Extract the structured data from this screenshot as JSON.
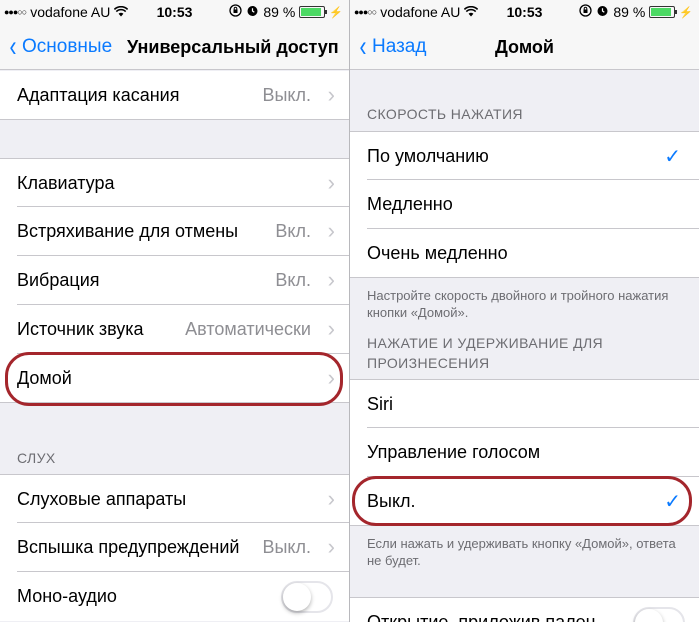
{
  "status_bar": {
    "signal": "●●●○○",
    "carrier": "vodafone AU",
    "wifi": "wifi-icon",
    "time": "10:53",
    "battery_percent": "89 %",
    "battery_level": 0.89
  },
  "left": {
    "nav": {
      "back_label": "Основные",
      "title": "Универсальный доступ"
    },
    "rows": {
      "touch_accommodations": {
        "label": "Адаптация касания",
        "value": "Выкл."
      },
      "keyboard": {
        "label": "Клавиатура"
      },
      "shake_to_undo": {
        "label": "Встряхивание для отмены",
        "value": "Вкл."
      },
      "vibration": {
        "label": "Вибрация",
        "value": "Вкл."
      },
      "audio_source": {
        "label": "Источник звука",
        "value": "Автоматически"
      },
      "home": {
        "label": "Домой"
      },
      "hearing_aids": {
        "label": "Слуховые аппараты"
      },
      "led_flash": {
        "label": "Вспышка предупреждений",
        "value": "Выкл."
      },
      "mono_audio": {
        "label": "Моно-аудио",
        "on": false
      }
    },
    "section_hearing": "СЛУХ"
  },
  "right": {
    "nav": {
      "back_label": "Назад",
      "title": "Домой"
    },
    "section_click_speed": "СКОРОСТЬ НАЖАТИЯ",
    "speed_options": [
      {
        "label": "По умолчанию",
        "selected": true
      },
      {
        "label": "Медленно",
        "selected": false
      },
      {
        "label": "Очень медленно",
        "selected": false
      }
    ],
    "speed_footer": "Настройте скорость двойного и тройного нажатия кнопки «Домой».",
    "section_press_hold": "НАЖАТИЕ И УДЕРЖИВАНИЕ ДЛЯ ПРОИЗНЕСЕНИЯ",
    "hold_options": [
      {
        "label": "Siri",
        "selected": false
      },
      {
        "label": "Управление голосом",
        "selected": false
      },
      {
        "label": "Выкл.",
        "selected": true
      }
    ],
    "hold_footer": "Если нажать и удерживать кнопку «Домой», ответа не будет.",
    "rest_finger": {
      "label": "Открытие, приложив палец",
      "on": false
    }
  },
  "colors": {
    "accent": "#0a7aff",
    "highlight": "#a4262c"
  }
}
